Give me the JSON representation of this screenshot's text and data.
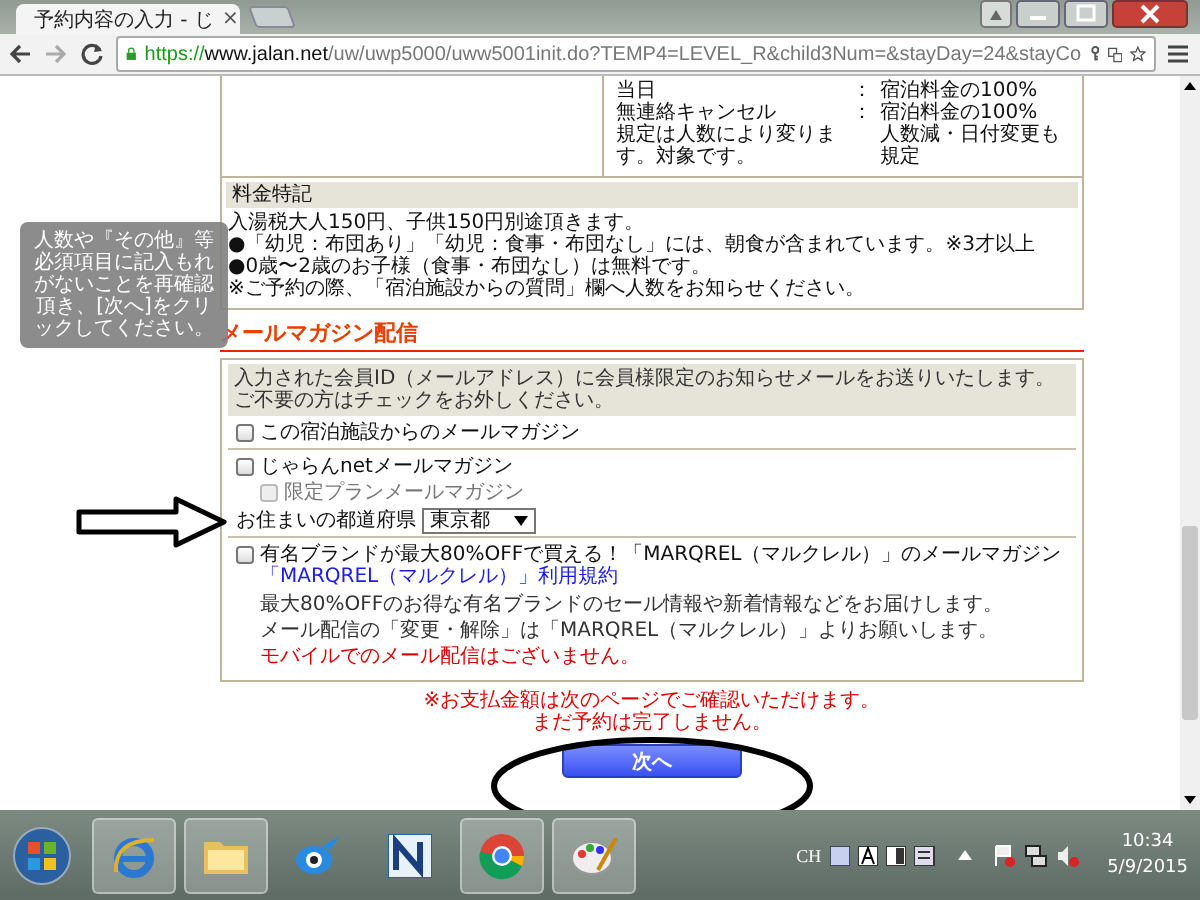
{
  "browser": {
    "tab_title": "予約内容の入力 - じ",
    "tab_close": "×",
    "url": {
      "scheme": "https://",
      "host": "www.jalan.net",
      "path": "/uw/uwp5000/uww5001init.do?TEMP4=LEVEL_R&child3Num=&stayDay=24&stayCo"
    }
  },
  "cancel_policy": {
    "rows": [
      {
        "label": "当日",
        "colon": "：",
        "value": "宿泊料金の100%"
      },
      {
        "label": "無連絡キャンセル",
        "colon": "：",
        "value": "宿泊料金の100%"
      },
      {
        "label": "規定は人数により変ります。対象です。",
        "value": "人数減・日付変更も規定"
      }
    ]
  },
  "fee_notes": {
    "title": "料金特記",
    "lines": [
      "入湯税大人150円、子供150円別途頂きます。",
      "●「幼児：布団あり」「幼児：食事・布団なし」には、朝食が含まれています。※3才以上",
      "●0歳〜2歳のお子様（食事・布団なし）は無料です。",
      "※ご予約の際、「宿泊施設からの質問」欄へ人数をお知らせください。"
    ]
  },
  "tooltip": "人数や『その他』等必須項目に記入もれがないことを再確認頂き、[次へ]をクリックしてください。",
  "mail": {
    "heading": "メールマガジン配信",
    "intro": "入力された会員ID（メールアドレス）に会員様限定のお知らせメールをお送りいたします。ご不要の方はチェックをお外しください。",
    "sections": [
      {
        "kind": "single",
        "options": [
          {
            "label": "この宿泊施設からのメールマガジン",
            "checked": false,
            "disabled": false
          }
        ]
      },
      {
        "kind": "group",
        "options": [
          {
            "label": "じゃらんnetメールマガジン",
            "checked": false,
            "disabled": false
          },
          {
            "label": "限定プランメールマガジン",
            "checked": false,
            "disabled": true
          }
        ],
        "select": {
          "label": "お住まいの都道府県",
          "value": "東京都"
        }
      },
      {
        "kind": "partner",
        "options": [
          {
            "label": "有名ブランドが最大80%OFFで買える！「MARQREL（マルクレル）」のメールマガジン",
            "checked": false,
            "disabled": false,
            "link": "「MARQREL（マルクレル）」利用規約"
          }
        ],
        "notes": [
          {
            "text": "最大80%OFFのお得な有名ブランドのセール情報や新着情報などをお届けします。",
            "kind": "plain"
          },
          {
            "text": "メール配信の「変更・解除」は「MARQREL（マルクレル）」よりお願いします。",
            "kind": "plain"
          },
          {
            "text": "モバイルでのメール配信はございません。",
            "kind": "warning"
          }
        ]
      }
    ]
  },
  "notices": [
    "※お支払金額は次のページでご確認いただけます。",
    "まだ予約は完了しません。"
  ],
  "next_button": "次へ",
  "taskbar": {
    "items": [
      {
        "kind": "ie",
        "running": true
      },
      {
        "kind": "folder",
        "running": true
      },
      {
        "kind": "bird",
        "running": false
      },
      {
        "kind": "n-app",
        "running": false
      },
      {
        "kind": "chrome",
        "running": true
      },
      {
        "kind": "paint",
        "running": true
      }
    ],
    "tray": {
      "language": "CH",
      "clock": "10:34",
      "date": "5/9/2015"
    }
  }
}
